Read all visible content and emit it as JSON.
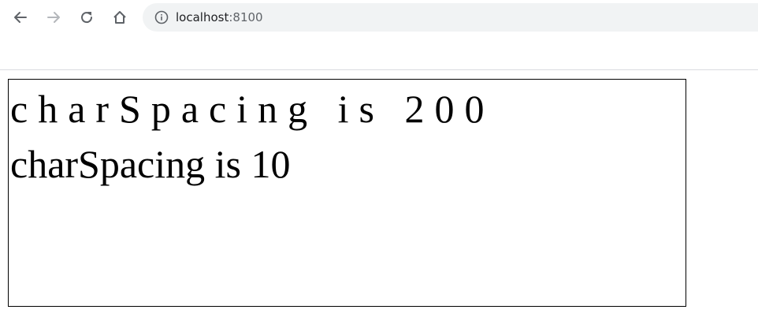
{
  "browser": {
    "nav": {
      "back_icon": "arrow-left-icon",
      "forward_icon": "arrow-right-icon",
      "reload_icon": "reload-icon",
      "home_icon": "home-icon"
    },
    "omnibox": {
      "info_icon": "info-icon",
      "host": "localhost",
      "port": ":8100"
    }
  },
  "canvas": {
    "lines": [
      "charSpacing is 200",
      "charSpacing is 10"
    ]
  }
}
